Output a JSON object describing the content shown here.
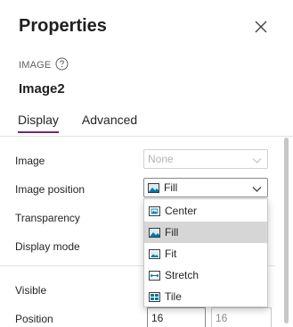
{
  "panel": {
    "title": "Properties",
    "control_type": "IMAGE",
    "control_name": "Image2"
  },
  "tabs": [
    "Display",
    "Advanced"
  ],
  "properties": {
    "image": {
      "label": "Image",
      "value": "None"
    },
    "image_position": {
      "label": "Image position",
      "value": "Fill",
      "options": [
        "Center",
        "Fill",
        "Fit",
        "Stretch",
        "Tile"
      ]
    },
    "transparency": {
      "label": "Transparency"
    },
    "display_mode": {
      "label": "Display mode"
    },
    "visible": {
      "label": "Visible"
    },
    "position": {
      "label": "Position",
      "x": "16",
      "y": "16"
    }
  },
  "icons": {
    "close": "close-icon",
    "help": "help-circle-icon",
    "dropdown": "chevron-down-icon",
    "image_center": "image-center-icon",
    "image_fill": "image-fill-icon",
    "image_fit": "image-fit-icon",
    "image_stretch": "image-stretch-icon",
    "image_tile": "image-tile-icon"
  },
  "colors": {
    "accent": "#742774",
    "selected_option": "#d6d6d6",
    "icon_teal": "#0078a8"
  }
}
